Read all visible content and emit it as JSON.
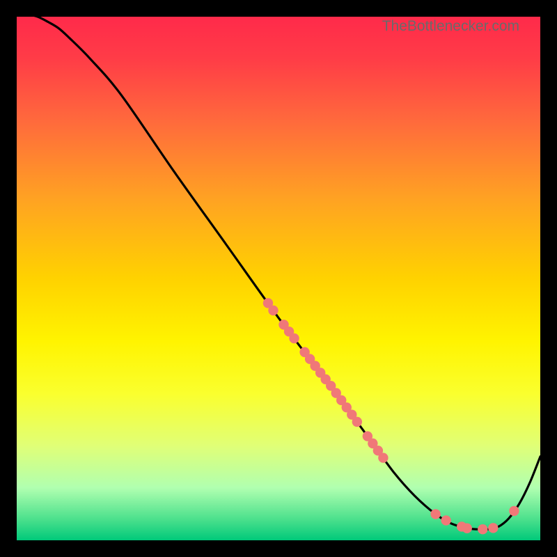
{
  "watermark": "TheBottlenecker.com",
  "chart_data": {
    "type": "line",
    "title": "",
    "xlabel": "",
    "ylabel": "",
    "xlim": [
      0,
      100
    ],
    "ylim": [
      0,
      100
    ],
    "series": [
      {
        "name": "curve",
        "x": [
          0,
          2,
          4,
          6,
          8,
          10,
          14,
          20,
          30,
          40,
          50,
          58,
          60,
          64,
          68,
          72,
          76,
          80,
          83,
          86,
          88,
          90,
          92,
          94,
          96,
          98,
          100
        ],
        "y": [
          101,
          100.5,
          100,
          99,
          97.8,
          96,
          92,
          85,
          70.5,
          56.5,
          42.5,
          32,
          29.5,
          24,
          18.5,
          13,
          8.5,
          5,
          3.2,
          2.3,
          2.1,
          2.1,
          2.6,
          4.2,
          7,
          11,
          16
        ]
      }
    ],
    "highlight_points_on_curve_x": [
      48,
      49,
      51,
      52,
      53,
      55,
      56,
      57,
      58,
      59,
      60,
      61,
      62,
      63,
      64,
      65,
      67,
      68,
      69,
      70,
      80,
      82,
      85,
      86,
      89,
      91,
      95
    ],
    "highlight_color": "#f07878",
    "curve_color": "#000000",
    "gradient_stops": [
      {
        "offset": 0.0,
        "color": "#ff2a4a"
      },
      {
        "offset": 0.08,
        "color": "#ff3c47"
      },
      {
        "offset": 0.2,
        "color": "#ff6a3c"
      },
      {
        "offset": 0.35,
        "color": "#ffa322"
      },
      {
        "offset": 0.5,
        "color": "#ffd200"
      },
      {
        "offset": 0.62,
        "color": "#fff400"
      },
      {
        "offset": 0.72,
        "color": "#faff2e"
      },
      {
        "offset": 0.82,
        "color": "#e0ff77"
      },
      {
        "offset": 0.9,
        "color": "#b0ffb0"
      },
      {
        "offset": 0.96,
        "color": "#4be08c"
      },
      {
        "offset": 1.0,
        "color": "#00c97a"
      }
    ]
  }
}
